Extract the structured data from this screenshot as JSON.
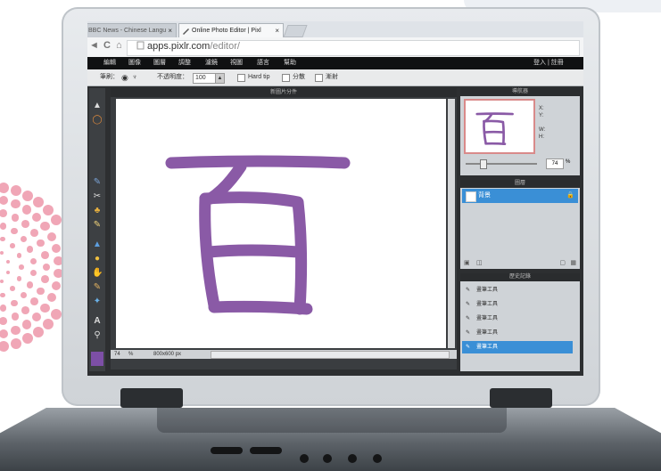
{
  "browser": {
    "tabs": [
      {
        "label": "BBC News - Chinese Langu",
        "close": "×"
      },
      {
        "label": "Online Photo Editor | Pixl",
        "close": "×"
      }
    ],
    "back_glyph": "◄",
    "forward_glyph": "►",
    "reload_glyph": "C",
    "home_glyph": "⌂",
    "url_host": "apps.pixlr.com",
    "url_path": "/editor/"
  },
  "pixlr": {
    "menu": [
      "編輯",
      "圖像",
      "圖層",
      "調整",
      "濾鏡",
      "視圖",
      "語言",
      "幫助"
    ],
    "menu_right": "登入 | 註冊",
    "options": {
      "brush_label": "筆刷：",
      "opacity_label": "不透明度：",
      "opacity_value": "100",
      "hard_tip_label": "Hard tip",
      "opt2_label": "分散",
      "opt3_label": "漸射"
    },
    "document": {
      "title": "新圖片分件",
      "canvas_character": "百",
      "zoom": "74",
      "zoom_unit": "%",
      "size": "800x600 px"
    },
    "navigator": {
      "title": "導航器",
      "x_label": "X:",
      "y_label": "Y:",
      "w_label": "W:",
      "h_label": "H:",
      "zoom": "74",
      "zoom_unit": "%"
    },
    "layers": {
      "title": "圖層",
      "items": [
        {
          "label": "背景"
        }
      ]
    },
    "history": {
      "title": "歷史記錄",
      "items": [
        "畫筆工具",
        "畫筆工具",
        "畫筆工具",
        "畫筆工具",
        "畫筆工具"
      ],
      "selected_index": 4
    },
    "tools": [
      "▲",
      "◯",
      "✎",
      "✂",
      "♣",
      "✎",
      "▲",
      "●",
      "✋",
      "✎",
      "✦",
      "A",
      "⚲"
    ],
    "primary_color": "#7d4fa6",
    "stroke_color": "#8a5aa6",
    "selection_color": "#3a8fd6"
  }
}
